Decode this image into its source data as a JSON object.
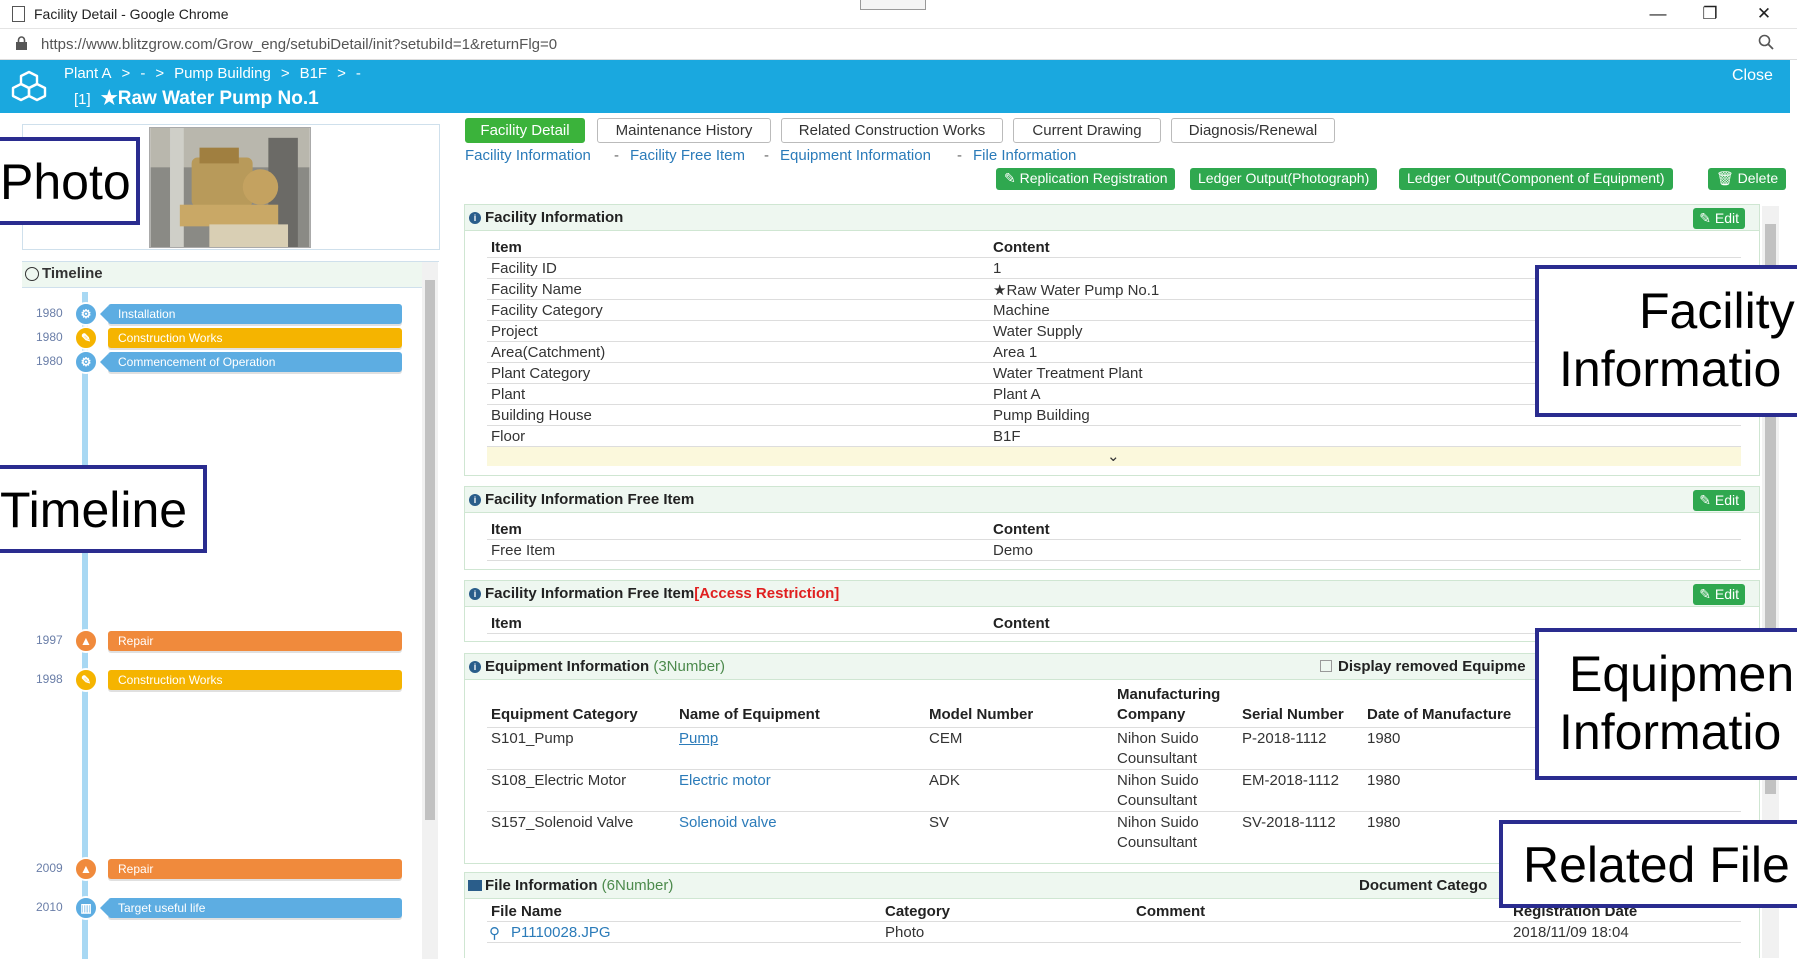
{
  "window": {
    "title": "Facility Detail - Google Chrome",
    "min": "—",
    "max": "❐",
    "close": "✕"
  },
  "address": {
    "url": "https://www.blitzgrow.com/Grow_eng/setubiDetail/init?setubiId=1&returnFlg=0"
  },
  "header": {
    "crumbs": [
      "Plant A",
      ">",
      "-",
      ">",
      "Pump Building",
      ">",
      "B1F",
      ">",
      "-"
    ],
    "index": "[1]",
    "title": "★Raw Water Pump No.1",
    "close": "Close",
    "color": "#1aa8df"
  },
  "timeline": {
    "title": "Timeline",
    "events": [
      {
        "year": "1980",
        "label": "Installation",
        "kind": "blue",
        "icon": "⚙"
      },
      {
        "year": "1980",
        "label": "Construction Works",
        "kind": "yel",
        "icon": "✎"
      },
      {
        "year": "1980",
        "label": "Commencement of Operation",
        "kind": "blue",
        "icon": "⚙"
      },
      {
        "year": "1997",
        "label": "Repair",
        "kind": "org",
        "icon": "▲"
      },
      {
        "year": "1998",
        "label": "Construction Works",
        "kind": "yel",
        "icon": "✎"
      },
      {
        "year": "2009",
        "label": "Repair",
        "kind": "org",
        "icon": "▲"
      },
      {
        "year": "2010",
        "label": "Target useful life",
        "kind": "blue",
        "icon": "▥"
      }
    ]
  },
  "tabs": [
    "Facility Detail",
    "Maintenance History",
    "Related Construction Works",
    "Current Drawing",
    "Diagnosis/Renewal"
  ],
  "sublinks": [
    "Facility Information",
    "-",
    "Facility Free Item",
    "-",
    "Equipment Information",
    "-",
    "File Information"
  ],
  "actions": [
    "✎ Replication Registration",
    "Ledger Output(Photograph)",
    "Ledger Output(Component of Equipment)",
    "🗑 Delete"
  ],
  "facility": {
    "title": "Facility Information",
    "edit": "✎ Edit",
    "col1": "Item",
    "col2": "Content",
    "rows": [
      [
        "Facility ID",
        "1"
      ],
      [
        "Facility Name",
        "★Raw Water Pump No.1"
      ],
      [
        "Facility Category",
        "Machine"
      ],
      [
        "Project",
        "Water Supply"
      ],
      [
        "Area(Catchment)",
        "Area 1"
      ],
      [
        "Plant Category",
        "Water Treatment Plant"
      ],
      [
        "Plant",
        "Plant A"
      ],
      [
        "Building House",
        "Pump Building"
      ],
      [
        "Floor",
        "B1F"
      ]
    ],
    "more": "⌄"
  },
  "free": {
    "title": "Facility Information Free Item",
    "edit": "✎ Edit",
    "col1": "Item",
    "col2": "Content",
    "rows": [
      [
        "Free Item",
        "Demo"
      ]
    ]
  },
  "freeR": {
    "title": "Facility Information Free Item",
    "restrict": "[Access Restriction]",
    "edit": "✎ Edit",
    "col1": "Item",
    "col2": "Content"
  },
  "equip": {
    "title": "Equipment Information",
    "count": "(3Number)",
    "removed": "Display removed Equipme",
    "cols": [
      "Equipment Category",
      "Name of Equipment",
      "Model Number",
      "Manufacturing",
      "Company",
      "Serial Number",
      "Date of Manufacture"
    ],
    "rows": [
      [
        "S101_Pump",
        "Pump",
        "CEM",
        "Nihon Suido",
        "Counsultant",
        "P-2018-1112",
        "1980"
      ],
      [
        "S108_Electric Motor",
        "Electric motor",
        "ADK",
        "Nihon Suido",
        "Counsultant",
        "EM-2018-1112",
        "1980"
      ],
      [
        "S157_Solenoid Valve",
        "Solenoid valve",
        "SV",
        "Nihon Suido",
        "Counsultant",
        "SV-2018-1112",
        "1980"
      ]
    ]
  },
  "files": {
    "title": "File Information",
    "count": "(6Number)",
    "doccat": "Document Catego",
    "cols": [
      "File Name",
      "Category",
      "Comment",
      "Registration Date"
    ],
    "rows": [
      [
        "P1110028.JPG",
        "Photo",
        "",
        "2018/11/09 18:04"
      ]
    ]
  },
  "callouts": {
    "photo": "Photo",
    "timeline": "Timeline",
    "facility1": "Facility",
    "facility2": "Informatio",
    "equip1": "Equipmen",
    "equip2": "Informatio",
    "related": "Related File"
  }
}
